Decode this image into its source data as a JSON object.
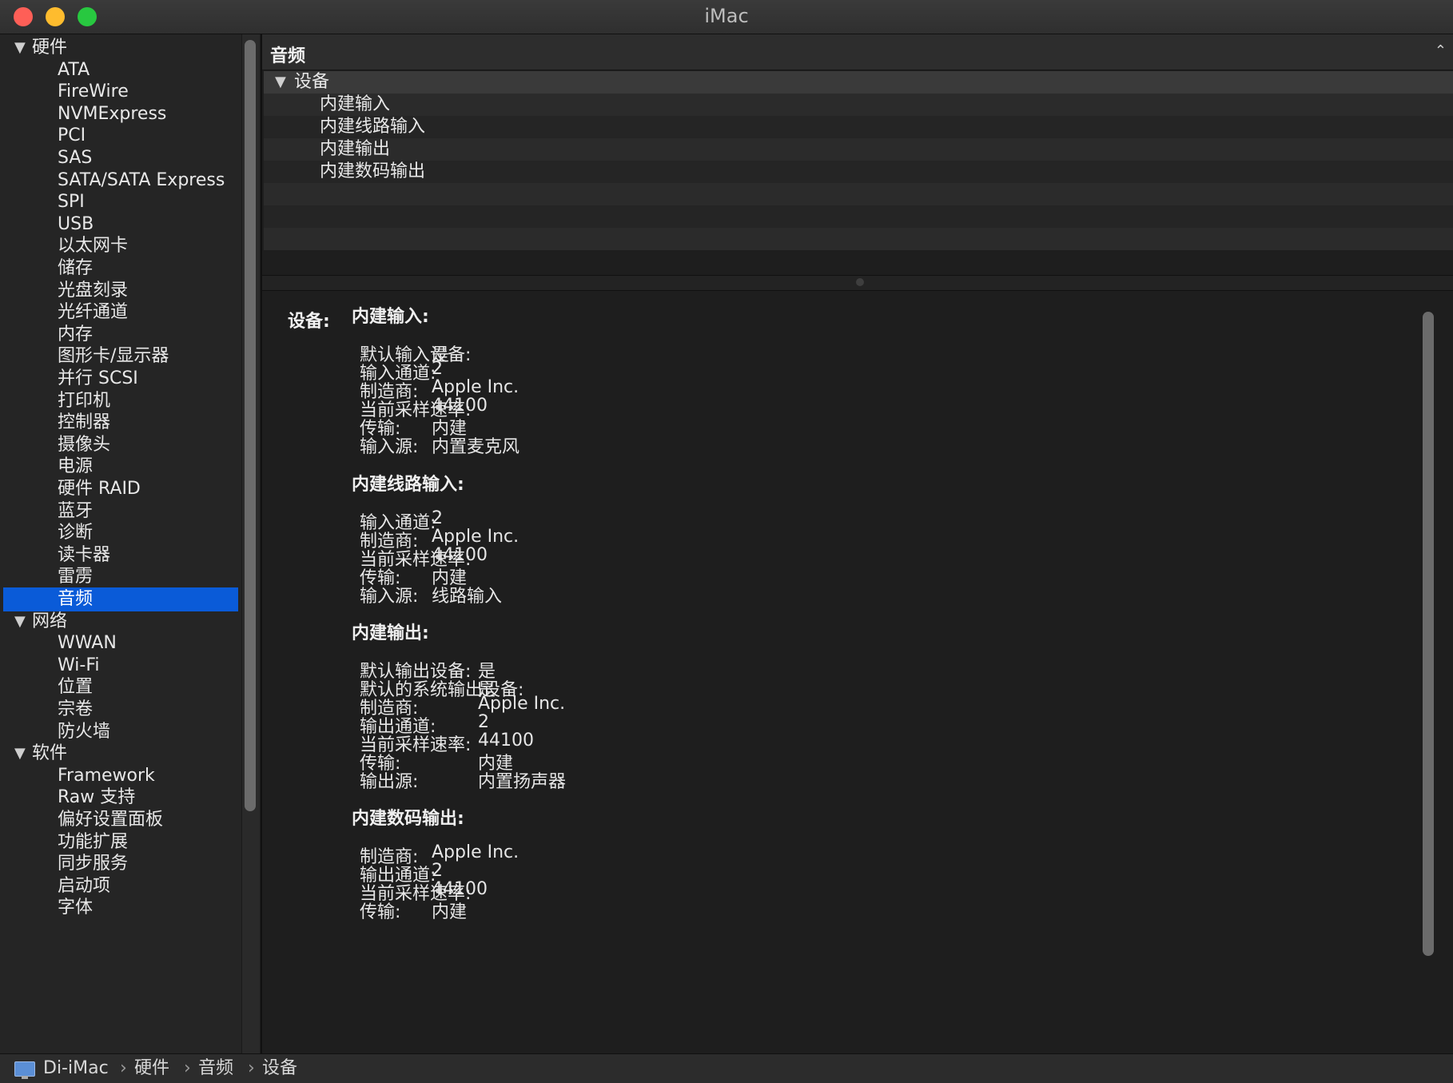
{
  "window": {
    "title": "iMac"
  },
  "sidebar": {
    "items": [
      {
        "type": "group",
        "label": "硬件",
        "collapse_icon": "triangle-down"
      },
      {
        "type": "child",
        "label": "ATA"
      },
      {
        "type": "child",
        "label": "FireWire"
      },
      {
        "type": "child",
        "label": "NVMExpress"
      },
      {
        "type": "child",
        "label": "PCI"
      },
      {
        "type": "child",
        "label": "SAS"
      },
      {
        "type": "child",
        "label": "SATA/SATA Express"
      },
      {
        "type": "child",
        "label": "SPI"
      },
      {
        "type": "child",
        "label": "USB"
      },
      {
        "type": "child",
        "label": "以太网卡"
      },
      {
        "type": "child",
        "label": "储存"
      },
      {
        "type": "child",
        "label": "光盘刻录"
      },
      {
        "type": "child",
        "label": "光纤通道"
      },
      {
        "type": "child",
        "label": "内存"
      },
      {
        "type": "child",
        "label": "图形卡/显示器"
      },
      {
        "type": "child",
        "label": "并行 SCSI"
      },
      {
        "type": "child",
        "label": "打印机"
      },
      {
        "type": "child",
        "label": "控制器"
      },
      {
        "type": "child",
        "label": "摄像头"
      },
      {
        "type": "child",
        "label": "电源"
      },
      {
        "type": "child",
        "label": "硬件 RAID"
      },
      {
        "type": "child",
        "label": "蓝牙"
      },
      {
        "type": "child",
        "label": "诊断"
      },
      {
        "type": "child",
        "label": "读卡器"
      },
      {
        "type": "child",
        "label": "雷雳"
      },
      {
        "type": "child",
        "label": "音频",
        "selected": true
      },
      {
        "type": "group",
        "label": "网络",
        "collapse_icon": "triangle-down"
      },
      {
        "type": "child",
        "label": "WWAN"
      },
      {
        "type": "child",
        "label": "Wi-Fi"
      },
      {
        "type": "child",
        "label": "位置"
      },
      {
        "type": "child",
        "label": "宗卷"
      },
      {
        "type": "child",
        "label": "防火墙"
      },
      {
        "type": "group",
        "label": "软件",
        "collapse_icon": "triangle-down"
      },
      {
        "type": "child",
        "label": "Framework"
      },
      {
        "type": "child",
        "label": "Raw 支持"
      },
      {
        "type": "child",
        "label": "偏好设置面板"
      },
      {
        "type": "child",
        "label": "功能扩展"
      },
      {
        "type": "child",
        "label": "同步服务"
      },
      {
        "type": "child",
        "label": "启动项"
      },
      {
        "type": "child",
        "label": "字体"
      }
    ]
  },
  "panel": {
    "title": "音频",
    "collapse_icon": "chevron-up",
    "list": {
      "group_label": "设备",
      "devices": [
        "内建输入",
        "内建线路输入",
        "内建输出",
        "内建数码输出"
      ]
    }
  },
  "detail": {
    "title": "设备:",
    "sections": [
      {
        "heading": "内建输入:",
        "rows": [
          {
            "key": "默认输入设备:",
            "value": "是"
          },
          {
            "key": "输入通道:",
            "value": "2"
          },
          {
            "key": "制造商:",
            "value": "Apple Inc."
          },
          {
            "key": "当前采样速率:",
            "value": "44100"
          },
          {
            "key": "传输:",
            "value": "内建"
          },
          {
            "key": "输入源:",
            "value": "内置麦克风"
          }
        ]
      },
      {
        "heading": "内建线路输入:",
        "rows": [
          {
            "key": "输入通道:",
            "value": "2"
          },
          {
            "key": "制造商:",
            "value": "Apple Inc."
          },
          {
            "key": "当前采样速率:",
            "value": "44100"
          },
          {
            "key": "传输:",
            "value": "内建"
          },
          {
            "key": "输入源:",
            "value": "线路输入"
          }
        ]
      },
      {
        "heading": "内建输出:",
        "rows": [
          {
            "key": "默认输出设备:",
            "value": "是"
          },
          {
            "key": "默认的系统输出设备:",
            "value": "是"
          },
          {
            "key": "制造商:",
            "value": "Apple Inc."
          },
          {
            "key": "输出通道:",
            "value": "2"
          },
          {
            "key": "当前采样速率:",
            "value": "44100"
          },
          {
            "key": "传输:",
            "value": "内建"
          },
          {
            "key": "输出源:",
            "value": "内置扬声器"
          }
        ]
      },
      {
        "heading": "内建数码输出:",
        "rows": [
          {
            "key": "制造商:",
            "value": "Apple Inc."
          },
          {
            "key": "输出通道:",
            "value": "2"
          },
          {
            "key": "当前采样速率:",
            "value": "44100"
          },
          {
            "key": "传输:",
            "value": "内建"
          }
        ]
      }
    ]
  },
  "pathbar": {
    "icon": "imac-icon",
    "crumbs": [
      "Di-iMac",
      "硬件",
      "音频",
      "设备"
    ]
  }
}
